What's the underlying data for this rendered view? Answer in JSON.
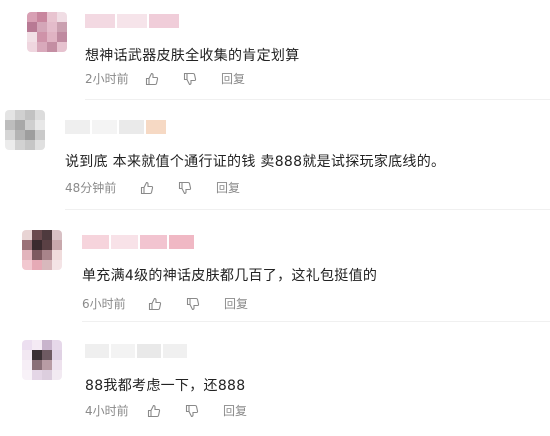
{
  "comments": [
    {
      "content": "想神话武器皮肤全收集的肯定划算",
      "time": "2小时前",
      "reply_label": "回复",
      "like_icon": "thumbs-up-icon",
      "dislike_icon": "thumbs-down-icon",
      "avatar_colors": [
        "#d8a0b4",
        "#c8869e",
        "#e8c4d0",
        "#f0dde4",
        "#b87a94",
        "#d4a6b8",
        "#e4bccb",
        "#caa0b0",
        "#f2e0e6",
        "#cf93a9",
        "#e0b3c3",
        "#bf8aa0",
        "#efd6df",
        "#d9a9bb",
        "#c48ea3",
        "#e6c2cf"
      ],
      "name_colors": [
        "#f3d9e2",
        "#f6e4ea",
        "#f0cdd9"
      ]
    },
    {
      "content": "说到底 本来就值个通行证的钱 卖888就是试探玩家底线的。",
      "time": "48分钟前",
      "reply_label": "回复",
      "like_icon": "thumbs-up-icon",
      "dislike_icon": "thumbs-down-icon",
      "avatar_colors": [
        "#e4e4e4",
        "#d0d0d0",
        "#c2c2c2",
        "#dcdcdc",
        "#bdbdbd",
        "#a8a8a8",
        "#cfcfcf",
        "#e8e8e8",
        "#d6d6d6",
        "#b4b4b4",
        "#9e9e9e",
        "#cacaca",
        "#ececec",
        "#d2d2d2",
        "#c6c6c6",
        "#e0e0e0"
      ],
      "name_colors": [
        "#efefef",
        "#f4f4f4",
        "#eaeaea",
        "#f6d9c4"
      ]
    },
    {
      "content": "单充满4级的神话皮肤都几百了，这礼包挺值的",
      "time": "6小时前",
      "reply_label": "回复",
      "like_icon": "thumbs-up-icon",
      "dislike_icon": "thumbs-down-icon",
      "avatar_colors": [
        "#e8d4d4",
        "#6a4a4e",
        "#4e3a3e",
        "#d8c0c4",
        "#9a7278",
        "#3a2a2e",
        "#5a4044",
        "#c8a8ac",
        "#e2b4bc",
        "#7e5a60",
        "#a8848a",
        "#f0dcdc",
        "#f2c8d0",
        "#e6aab6",
        "#d8b8bc",
        "#f4e4e6"
      ],
      "name_colors": [
        "#f6d4dc",
        "#f8e2e8",
        "#f2c4d0",
        "#f0b8c4"
      ]
    },
    {
      "content": "88我都考虑一下，还888",
      "time": "4小时前",
      "reply_label": "回复",
      "like_icon": "thumbs-up-icon",
      "dislike_icon": "thumbs-down-icon",
      "avatar_colors": [
        "#ecdff0",
        "#f4eaf4",
        "#c8b4cc",
        "#e6d8ea",
        "#f2e8f2",
        "#3a3034",
        "#6e5a62",
        "#e0d2e4",
        "#f6eef6",
        "#8a7078",
        "#b89ca4",
        "#eee2ee",
        "#f8f2f8",
        "#e4d6e6",
        "#dccede",
        "#f2eaf2"
      ],
      "name_colors": [
        "#efefef",
        "#f3f3f3",
        "#e9e9e9",
        "#f0f0f0"
      ]
    }
  ]
}
